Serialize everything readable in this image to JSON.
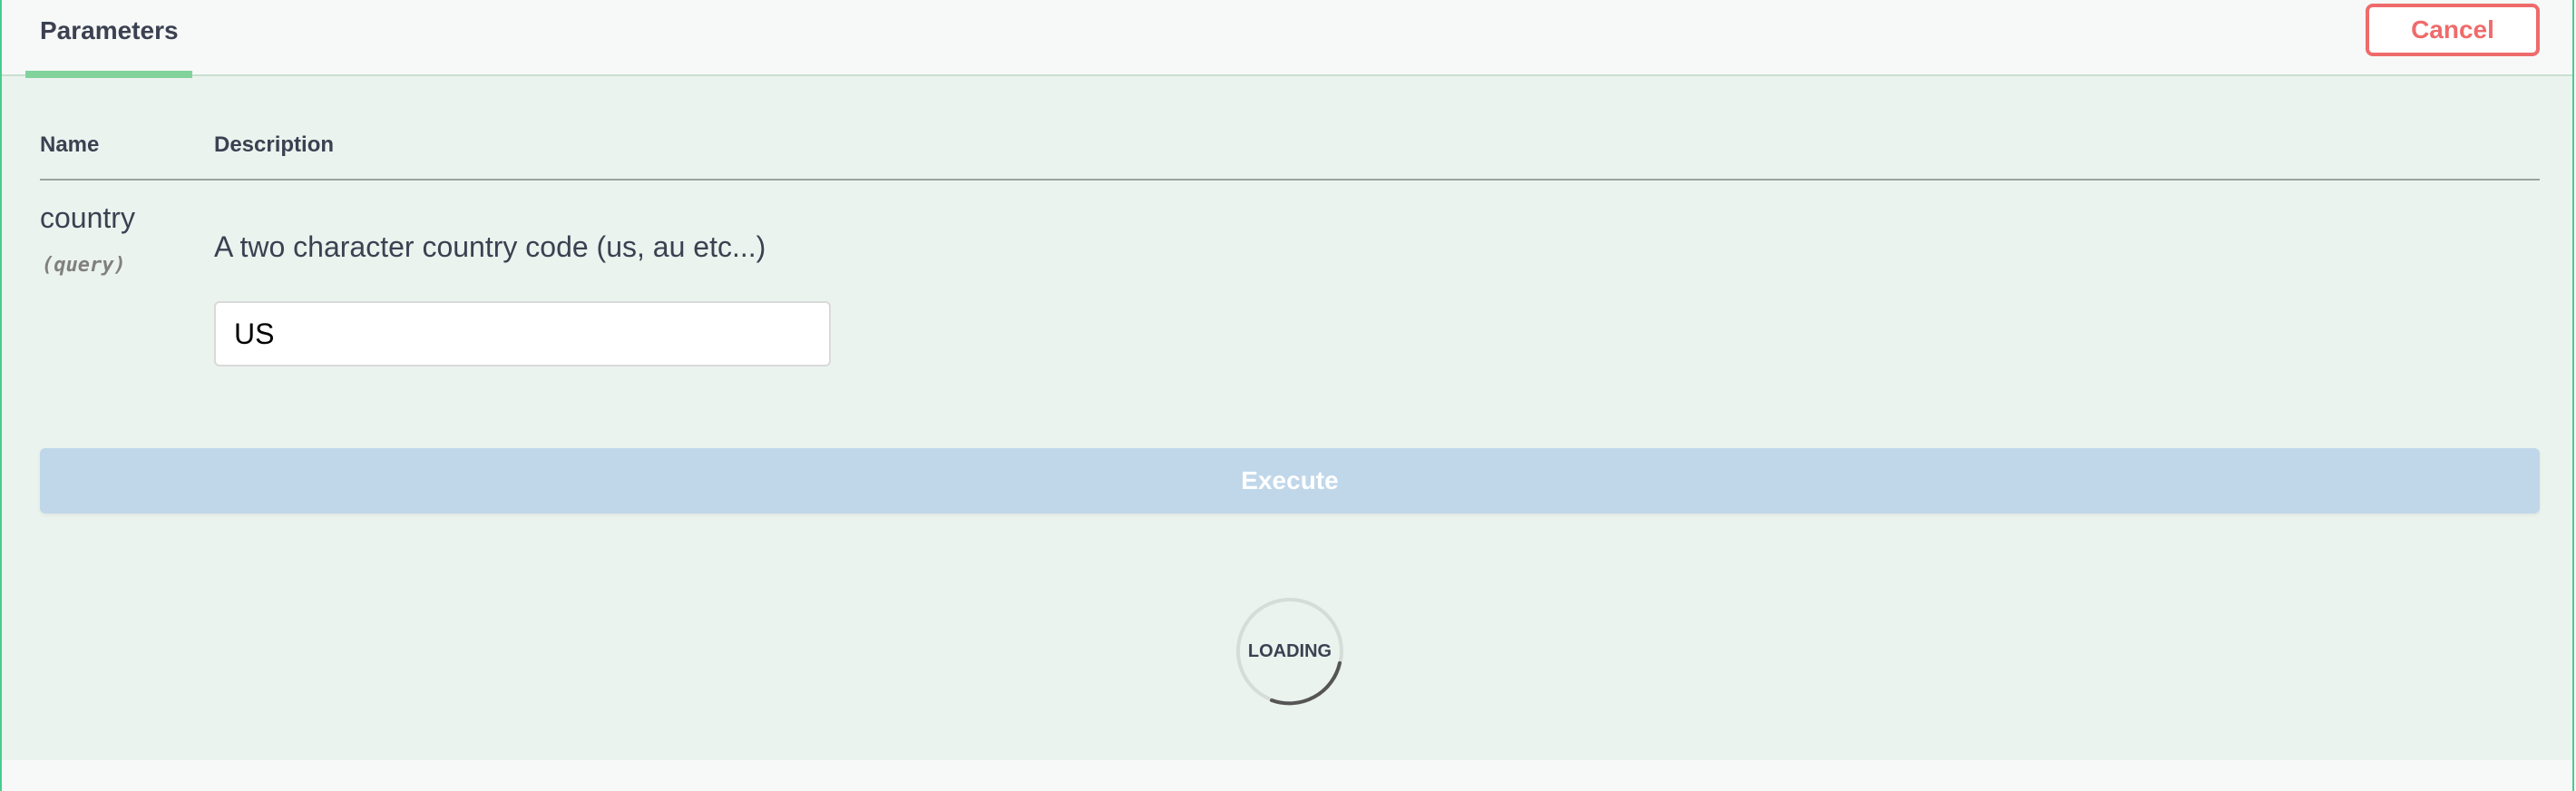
{
  "tabs": {
    "parameters_label": "Parameters"
  },
  "actions": {
    "cancel_label": "Cancel",
    "execute_label": "Execute"
  },
  "table": {
    "columns": [
      "Name",
      "Description"
    ],
    "rows": [
      {
        "name": "country",
        "location": "(query)",
        "description": "A two character country code (us, au etc...)",
        "value": "US"
      }
    ]
  },
  "status": {
    "loading_label": "LOADING"
  },
  "colors": {
    "accent_green": "#49cc90",
    "tab_underline": "#81d29b",
    "cancel_red": "#ef6b6b",
    "execute_disabled_blue": "#c0d7ea",
    "panel_background": "#ebf3ee"
  }
}
